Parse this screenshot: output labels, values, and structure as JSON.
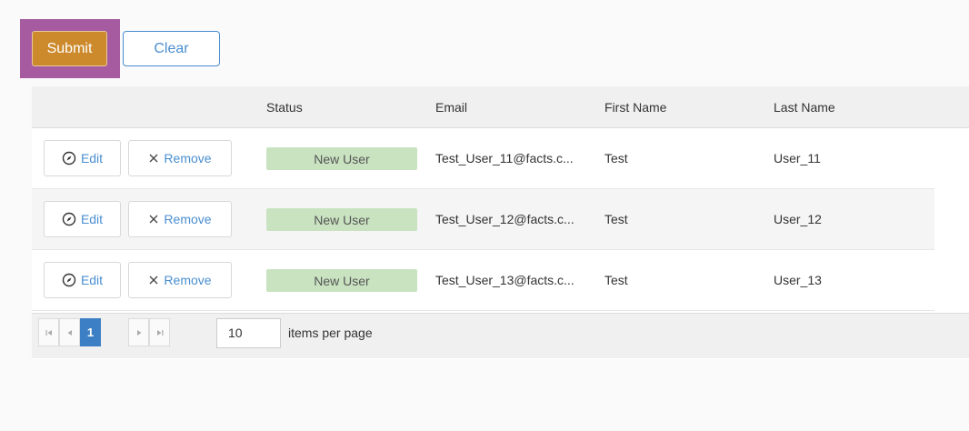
{
  "toolbar": {
    "submit_label": "Submit",
    "clear_label": "Clear",
    "highlight_color": "#a65ba0",
    "submit_color": "#cc8a2c"
  },
  "grid": {
    "columns": [
      "Status",
      "Email",
      "First Name",
      "Last Name"
    ],
    "rows": [
      {
        "edit": "Edit",
        "remove": "Remove",
        "status": "New User",
        "email": "Test_User_11@facts.c...",
        "first_name": "Test",
        "last_name": "User_11"
      },
      {
        "edit": "Edit",
        "remove": "Remove",
        "status": "New User",
        "email": "Test_User_12@facts.c...",
        "first_name": "Test",
        "last_name": "User_12"
      },
      {
        "edit": "Edit",
        "remove": "Remove",
        "status": "New User",
        "email": "Test_User_13@facts.c...",
        "first_name": "Test",
        "last_name": "User_13"
      }
    ],
    "status_color": "#c9e3c1",
    "action_icons": {
      "edit": "compass-icon",
      "remove": "close-icon"
    }
  },
  "pager": {
    "first_icon": "first-page-icon",
    "prev_icon": "prev-page-icon",
    "current_page": "1",
    "next_icon": "next-page-icon",
    "last_icon": "last-page-icon",
    "page_size": "10",
    "page_size_label": "items per page",
    "accent_color": "#3d7fc4"
  }
}
